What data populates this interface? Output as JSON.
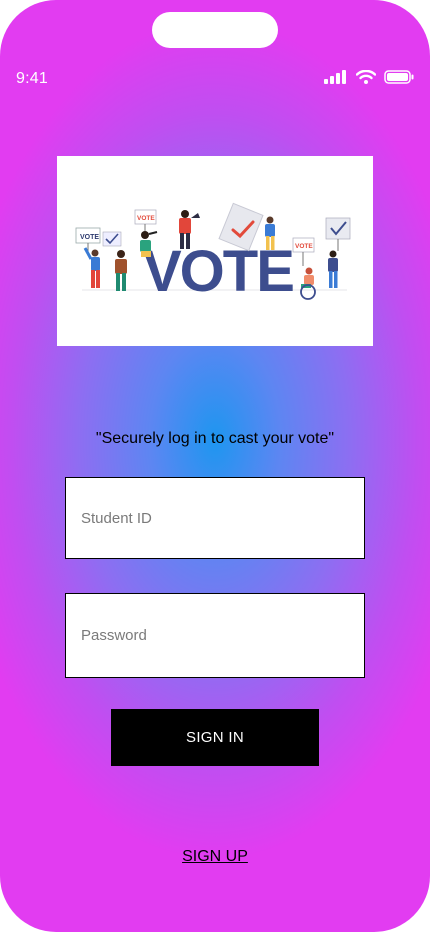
{
  "status_bar": {
    "time": "9:41",
    "icons": [
      "cellular-signal-icon",
      "wifi-icon",
      "battery-icon"
    ]
  },
  "hero": {
    "image_text": "VOTE",
    "sign_text": "VOTE",
    "icon": "vote-rally-illustration"
  },
  "login": {
    "tagline": "\"Securely log in to cast your vote\"",
    "student_id_placeholder": "Student ID",
    "password_placeholder": "Password",
    "sign_in_label": "SIGN IN",
    "sign_up_label": "SIGN UP"
  },
  "colors": {
    "gradient_center": "#1e96f0",
    "gradient_mid": "#8d6ef2",
    "gradient_edge": "#e23cf1",
    "button_bg": "#000000",
    "vote_text": "#3d4d8e"
  }
}
